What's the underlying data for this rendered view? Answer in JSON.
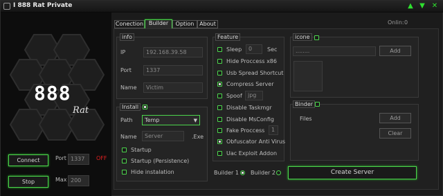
{
  "window": {
    "title": "I 888 Rat Private",
    "controls": [
      "▲",
      "▼",
      "✕"
    ]
  },
  "online": {
    "label": "Onlin:",
    "value": "0"
  },
  "logo": {
    "main": "888",
    "sub": "Rat"
  },
  "connect": {
    "button": "Connect",
    "port_label": "Port",
    "port_value": "1337",
    "status": "OFF"
  },
  "stop": {
    "button": "Stop",
    "max_label": "Max",
    "max_value": "200"
  },
  "tabs": [
    {
      "label": "Conection"
    },
    {
      "label": "Builder"
    },
    {
      "label": "Option"
    },
    {
      "label": "About"
    }
  ],
  "info": {
    "title": "info",
    "ip_label": "IP",
    "ip_value": "192.168.39.58",
    "port_label": "Port",
    "port_value": "1337",
    "name_label": "Name",
    "name_value": "Victim"
  },
  "install": {
    "title": "Install",
    "path_label": "Path",
    "path_value": "Temp",
    "name_label": "Name",
    "name_value": "Server",
    "ext": ".Exe",
    "startup": "Startup",
    "startup_persist": "Startup (Persistence)",
    "hide": "Hide instalation"
  },
  "feature": {
    "title": "Feature",
    "sleep": "Sleep",
    "sleep_value": "0",
    "sleep_unit": "Sec",
    "hide_process": "Hide Proccess x86",
    "usb": "Usb Spread Shortcut",
    "compress": "Compress Server",
    "spoof": "Spoof",
    "spoof_value": "jpg",
    "taskmgr": "Disable Taskmgr",
    "msconfig": "Disable MsConfig",
    "fake": "Fake Proccess",
    "fake_value": "1",
    "obfuscator": "Obfuscator Anti Virus",
    "uac": "Uac Exploit Addon"
  },
  "icone": {
    "title": "icone",
    "path_value": "........",
    "add": "Add"
  },
  "binder": {
    "title": "Binder",
    "files": "Files",
    "add": "Add",
    "clear": "Clear"
  },
  "builder": {
    "b1": "Builder 1",
    "b2": "Builder 2",
    "create": "Create Server"
  },
  "colors": {
    "accent": "#4cd64c",
    "off": "#e02020"
  }
}
